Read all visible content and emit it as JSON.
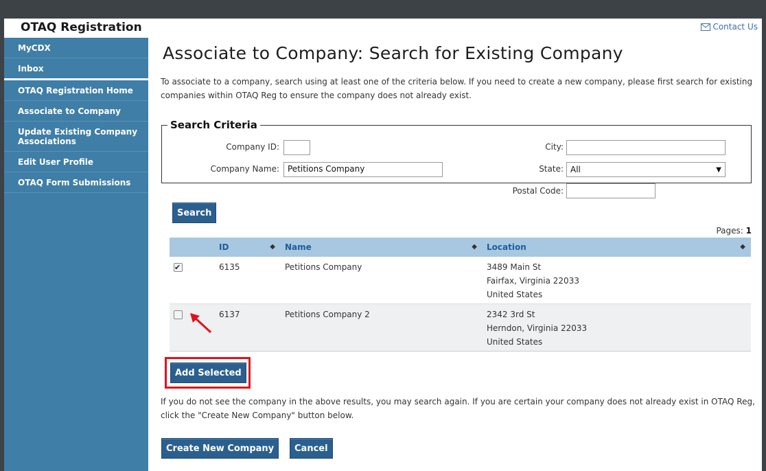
{
  "header": {
    "app_title": "OTAQ Registration",
    "contact_label": "Contact Us"
  },
  "sidebar": {
    "items": [
      {
        "label": "MyCDX"
      },
      {
        "label": "Inbox"
      },
      {
        "label": "OTAQ Registration Home"
      },
      {
        "label": "Associate to Company"
      },
      {
        "label": "Update Existing Company Associations"
      },
      {
        "label": "Edit User Profile"
      },
      {
        "label": "OTAQ Form Submissions"
      }
    ]
  },
  "main": {
    "title": "Associate to Company: Search for Existing Company",
    "intro": "To associate to a company, search using at least one of the criteria below. If you need to create a new company, please first search for existing companies within OTAQ Reg to ensure the company does not already exist.",
    "criteria": {
      "legend": "Search Criteria",
      "company_id_label": "Company ID:",
      "company_id_value": "",
      "company_name_label": "Company Name:",
      "company_name_value": "Petitions Company",
      "city_label": "City:",
      "city_value": "",
      "state_label": "State:",
      "state_value": "All",
      "postal_label": "Postal Code:",
      "postal_value": ""
    },
    "search_button": "Search",
    "pages_label": "Pages:",
    "pages_value": "1",
    "table": {
      "headers": {
        "id": "ID",
        "name": "Name",
        "location": "Location"
      },
      "rows": [
        {
          "checked": true,
          "id": "6135",
          "name": "Petitions Company",
          "street": "3489 Main St",
          "city_state": "Fairfax, Virginia 22033",
          "country": "United States"
        },
        {
          "checked": false,
          "id": "6137",
          "name": "Petitions Company 2",
          "street": "2342 3rd St",
          "city_state": "Herndon, Virginia 22033",
          "country": "United States"
        }
      ]
    },
    "add_selected_button": "Add Selected",
    "after_text": "If you do not see the company in the above results, you may search again. If you are certain your company does not already exist in OTAQ Reg, click the \"Create New Company\" button below.",
    "create_button": "Create New Company",
    "cancel_button": "Cancel"
  },
  "colors": {
    "sidebar": "#3f7ea6",
    "button": "#2b5f8e",
    "table_header": "#a8c8e2",
    "highlight": "#e0121b"
  }
}
